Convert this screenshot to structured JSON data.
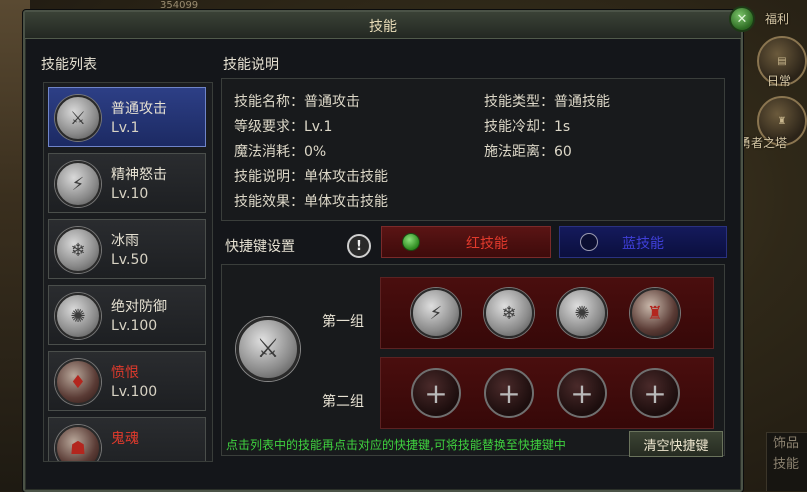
{
  "background": {
    "top_number": "354099",
    "hud": {
      "welfare_label": "福利",
      "daily_label": "日常",
      "tower_label": "勇者之塔",
      "corner_lines": [
        "饰品",
        "技能"
      ]
    }
  },
  "window": {
    "title": "技能",
    "close_icon": "close-icon"
  },
  "skill_list": {
    "title": "技能列表",
    "items": [
      {
        "name": "普通攻击",
        "level": "Lv.1",
        "icon": "sword-icon",
        "glyph": "⚔",
        "selected": true,
        "red": false
      },
      {
        "name": "精神怒击",
        "level": "Lv.10",
        "icon": "lightning-icon",
        "glyph": "⚡",
        "selected": false,
        "red": false
      },
      {
        "name": "冰雨",
        "level": "Lv.50",
        "icon": "ice-rain-icon",
        "glyph": "❄",
        "selected": false,
        "red": false
      },
      {
        "name": "绝对防御",
        "level": "Lv.100",
        "icon": "shield-swirl-icon",
        "glyph": "✺",
        "selected": false,
        "red": false
      },
      {
        "name": "愤恨",
        "level": "Lv.100",
        "icon": "hatred-icon",
        "glyph": "♦",
        "selected": false,
        "red": true
      },
      {
        "name": "鬼魂",
        "level": "",
        "icon": "ghost-icon",
        "glyph": "☗",
        "selected": false,
        "red": true
      }
    ]
  },
  "skill_info": {
    "title": "技能说明",
    "name_label": "技能名称：",
    "name_value": "普通攻击",
    "type_label": "技能类型：",
    "type_value": "普通技能",
    "level_req_label": "等级要求：",
    "level_req_value": "Lv.1",
    "cooldown_label": "技能冷却：",
    "cooldown_value": "1s",
    "mana_label": "魔法消耗：",
    "mana_value": "0%",
    "range_label": "施法距离：",
    "range_value": "60",
    "desc_label": "技能说明：",
    "desc_value": "单体攻击技能",
    "effect_label": "技能效果：",
    "effect_value": "单体攻击技能"
  },
  "hotkeys": {
    "title": "快捷键设置",
    "red_tab": {
      "label": "红技能",
      "color": "#e23a2c"
    },
    "blue_tab": {
      "label": "蓝技能",
      "color": "#3f3fd8"
    },
    "selected_icon": "sword-icon",
    "selected_glyph": "⚔",
    "group1_label": "第一组",
    "group2_label": "第二组",
    "group1_slots": [
      {
        "icon": "lightning-icon",
        "glyph": "⚡",
        "red": false
      },
      {
        "icon": "ice-rain-icon",
        "glyph": "❄",
        "red": false
      },
      {
        "icon": "shield-swirl-icon",
        "glyph": "✺",
        "red": false
      },
      {
        "icon": "demon-icon",
        "glyph": "♜",
        "red": true
      }
    ],
    "group2_slots": [
      {
        "icon": "plus-icon",
        "glyph": "+"
      },
      {
        "icon": "plus-icon",
        "glyph": "+"
      },
      {
        "icon": "plus-icon",
        "glyph": "+"
      },
      {
        "icon": "plus-icon",
        "glyph": "+"
      }
    ],
    "hint": "点击列表中的技能再点击对应的快捷键,可将技能替换至快捷键中",
    "clear_button": "清空快捷键"
  }
}
